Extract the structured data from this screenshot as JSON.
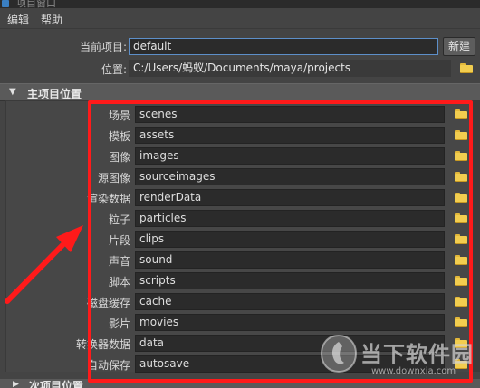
{
  "window": {
    "title": "项目窗口"
  },
  "menu": [
    {
      "label": "编辑"
    },
    {
      "label": "帮助"
    }
  ],
  "top": {
    "current_project_label": "当前项目:",
    "current_project_value": "default",
    "new_button": "新建",
    "location_label": "位置:",
    "location_value": "C:/Users/蚂蚁/Documents/maya/projects"
  },
  "primary_section": {
    "title": "主项目位置",
    "rows": [
      {
        "label": "场景",
        "value": "scenes"
      },
      {
        "label": "模板",
        "value": "assets"
      },
      {
        "label": "图像",
        "value": "images"
      },
      {
        "label": "源图像",
        "value": "sourceimages"
      },
      {
        "label": "渲染数据",
        "value": "renderData"
      },
      {
        "label": "粒子",
        "value": "particles"
      },
      {
        "label": "片段",
        "value": "clips"
      },
      {
        "label": "声音",
        "value": "sound"
      },
      {
        "label": "脚本",
        "value": "scripts"
      },
      {
        "label": "磁盘缓存",
        "value": "cache"
      },
      {
        "label": "影片",
        "value": "movies"
      },
      {
        "label": "转换器数据",
        "value": "data"
      },
      {
        "label": "自动保存",
        "value": "autosave"
      }
    ]
  },
  "secondary_section": {
    "title": "次项目位置"
  },
  "watermark": {
    "brand": "当下软件园",
    "url": "www.downxia.com"
  },
  "colors": {
    "highlight": "#ff1a1a",
    "folder": "#f2cd4f",
    "field_bg": "#2b2b2b",
    "panel_bg": "#474747"
  },
  "icons": {
    "folder": "folder-icon",
    "section_open": "triangle-down-icon",
    "section_closed": "triangle-right-icon"
  }
}
